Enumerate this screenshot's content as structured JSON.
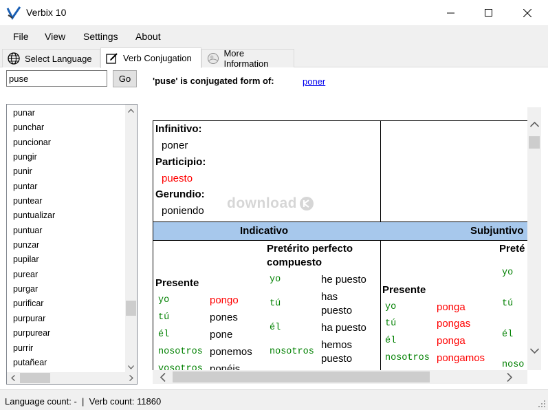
{
  "window": {
    "title": "Verbix 10"
  },
  "menu": [
    "File",
    "View",
    "Settings",
    "About"
  ],
  "tabs": [
    {
      "label": "Select Language",
      "icon": "globe-icon"
    },
    {
      "label": "Verb Conjugation",
      "icon": "edit-icon"
    },
    {
      "label": "More Information",
      "icon": "info-icon"
    }
  ],
  "search": {
    "value": "puse",
    "go_label": "Go"
  },
  "verb_list": [
    "punar",
    "punchar",
    "puncionar",
    "pungir",
    "punir",
    "puntar",
    "puntear",
    "puntualizar",
    "puntuar",
    "punzar",
    "pupilar",
    "purear",
    "purgar",
    "purificar",
    "purpurar",
    "purpurear",
    "purrir",
    "putañear"
  ],
  "conjugation": {
    "header": "'puse' is conjugated form of:",
    "base_link": "poner",
    "infinitive_label": "Infinitivo:",
    "infinitive": "poner",
    "participle_label": "Participio:",
    "participle": "puesto",
    "gerund_label": "Gerundio:",
    "gerund": "poniendo",
    "watermark": "download",
    "indicative_label": "Indicativo",
    "subjunctive_label": "Subjuntivo",
    "perfect_label": "Pretérito perfecto compuesto",
    "perfect_label_line1": "Pretérito perfecto",
    "perfect_label_line2": "compuesto",
    "subj_perfect_label": "Preté",
    "present_label": "Presente",
    "subj_present_label": "Presente",
    "present": [
      {
        "pron": "yo",
        "verb": "pongo"
      },
      {
        "pron": "tú",
        "verb": "pones"
      },
      {
        "pron": "él",
        "verb": "pone"
      },
      {
        "pron": "nosotros",
        "verb": "ponemos"
      },
      {
        "pron": "vosotros",
        "verb": "ponéis"
      }
    ],
    "perfect": [
      {
        "pron": "yo",
        "verb": "he puesto"
      },
      {
        "pron": "tú",
        "verb_line1": "has",
        "verb_line2": "puesto"
      },
      {
        "pron": "él",
        "verb": "ha puesto"
      },
      {
        "pron": "nosotros",
        "verb_line1": "hemos",
        "verb_line2": "puesto"
      }
    ],
    "subj_present": [
      {
        "pron": "yo",
        "verb": "ponga"
      },
      {
        "pron": "tú",
        "verb": "pongas"
      },
      {
        "pron": "él",
        "verb": "ponga"
      },
      {
        "pron": "nosotros",
        "verb": "pongamos"
      }
    ],
    "subj_perfect_prons": [
      "yo",
      "tú",
      "él",
      "noso"
    ]
  },
  "status": {
    "text": "Language count: -  |  Verb count: 11860"
  },
  "colors": {
    "irregular": "#ff0000",
    "pronoun": "#008000",
    "band": "#a7c8ec",
    "link": "#0000ee"
  }
}
